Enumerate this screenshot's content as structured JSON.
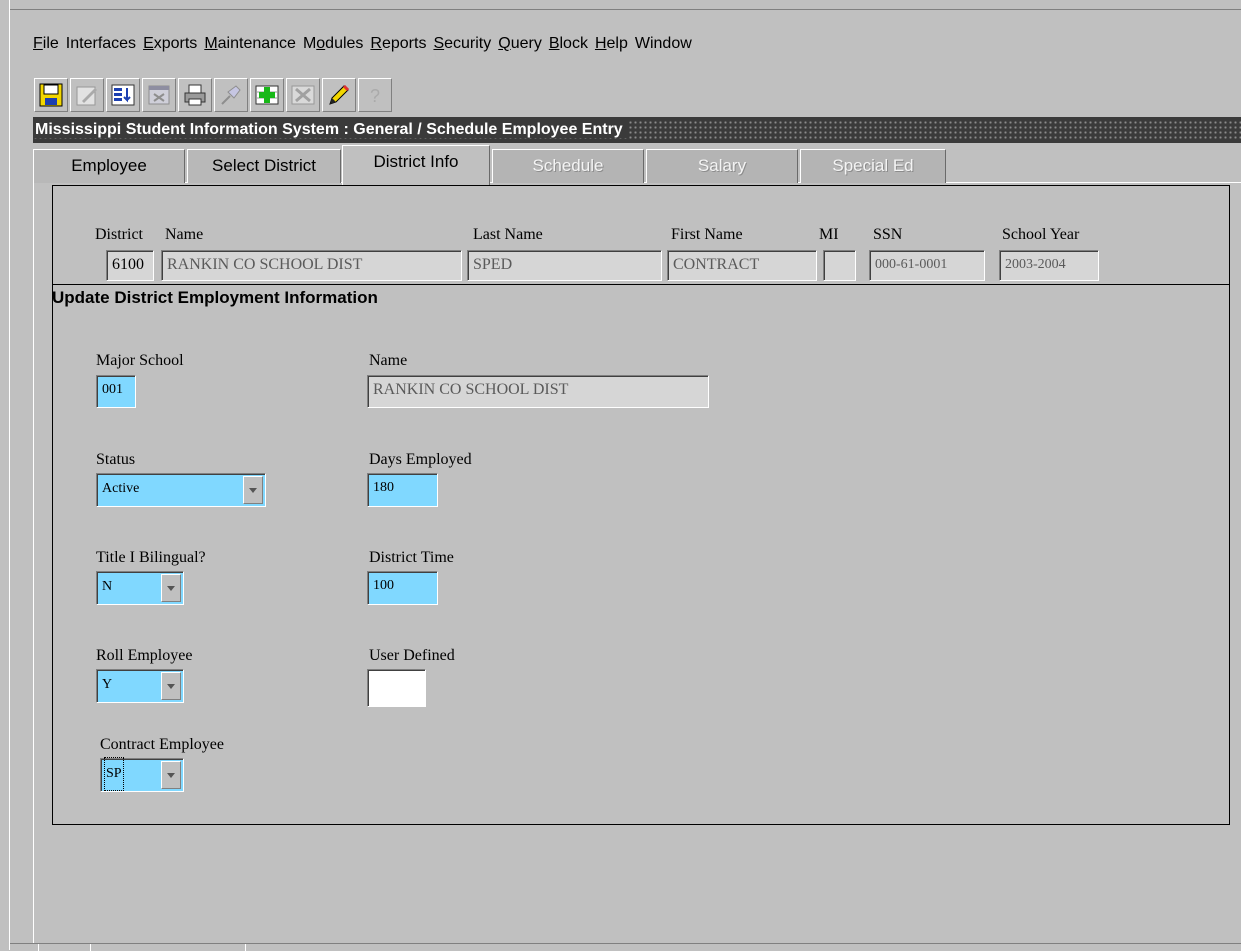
{
  "menu": [
    "File",
    "Interfaces",
    "Exports",
    "Maintenance",
    "Modules",
    "Reports",
    "Security",
    "Query",
    "Block",
    "Help",
    "Window"
  ],
  "toolbar": [
    "save-icon",
    "edit-icon",
    "list-icon",
    "window-icon",
    "print-icon",
    "pin-icon",
    "insert-icon",
    "delete-icon",
    "pencil-icon",
    "help-icon"
  ],
  "window_title": "Mississippi Student Information System : General / Schedule Employee Entry",
  "tabs": [
    {
      "label": "Employee",
      "state": "normal"
    },
    {
      "label": "Select District",
      "state": "normal"
    },
    {
      "label": "District Info",
      "state": "active"
    },
    {
      "label": "Schedule",
      "state": "disabled"
    },
    {
      "label": "Salary",
      "state": "disabled"
    },
    {
      "label": "Special Ed",
      "state": "disabled"
    }
  ],
  "header": {
    "district_label": "District",
    "district_value": "6100",
    "name_label": "Name",
    "name_value": "RANKIN CO SCHOOL DIST",
    "last_name_label": "Last Name",
    "last_name_value": "SPED",
    "first_name_label": "First Name",
    "first_name_value": "CONTRACT",
    "mi_label": "MI",
    "mi_value": "",
    "ssn_label": "SSN",
    "ssn_value": "000-61-0001",
    "school_year_label": "School Year",
    "school_year_value": "2003-2004"
  },
  "section_title": "Update District Employment Information",
  "form": {
    "major_school_label": "Major School",
    "major_school_value": "001",
    "school_name_label": "Name",
    "school_name_value": "RANKIN CO SCHOOL DIST",
    "status_label": "Status",
    "status_value": "Active",
    "days_employed_label": "Days Employed",
    "days_employed_value": "180",
    "title1_label": "Title I Bilingual?",
    "title1_value": "N",
    "district_time_label": "District Time",
    "district_time_value": "100",
    "roll_label": "Roll Employee",
    "roll_value": "Y",
    "user_defined_label": "User Defined",
    "user_defined_value": "",
    "contract_label": "Contract Employee",
    "contract_value": "SP"
  }
}
